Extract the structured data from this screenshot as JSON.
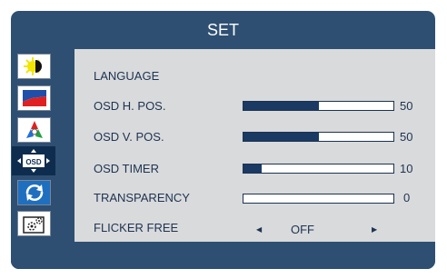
{
  "header": {
    "title": "SET"
  },
  "menu": {
    "language": {
      "label": "LANGUAGE"
    },
    "osd_h_pos": {
      "label": "OSD H. POS.",
      "value": "50",
      "level": 0.5
    },
    "osd_v_pos": {
      "label": "OSD V. POS.",
      "value": "50",
      "level": 0.5
    },
    "osd_timer": {
      "label": "OSD TIMER",
      "value": "10",
      "level": 0.12
    },
    "transparency": {
      "label": "TRANSPARENCY",
      "value": "0",
      "level": 0
    },
    "flicker_free": {
      "label": "FLICKER FREE",
      "value": "OFF"
    }
  },
  "sidebar": {
    "items": [
      {
        "icon": "brightness-icon"
      },
      {
        "icon": "picture-icon"
      },
      {
        "icon": "color-icon"
      },
      {
        "icon": "osd-icon",
        "text": "OSD",
        "selected": true
      },
      {
        "icon": "reset-icon"
      },
      {
        "icon": "settings-icon"
      }
    ]
  },
  "colors": {
    "frame": "#2e4f72",
    "panel": "#d9dadc",
    "bar_fill": "#1a3a64",
    "selected_item": "#0e2c4e"
  }
}
